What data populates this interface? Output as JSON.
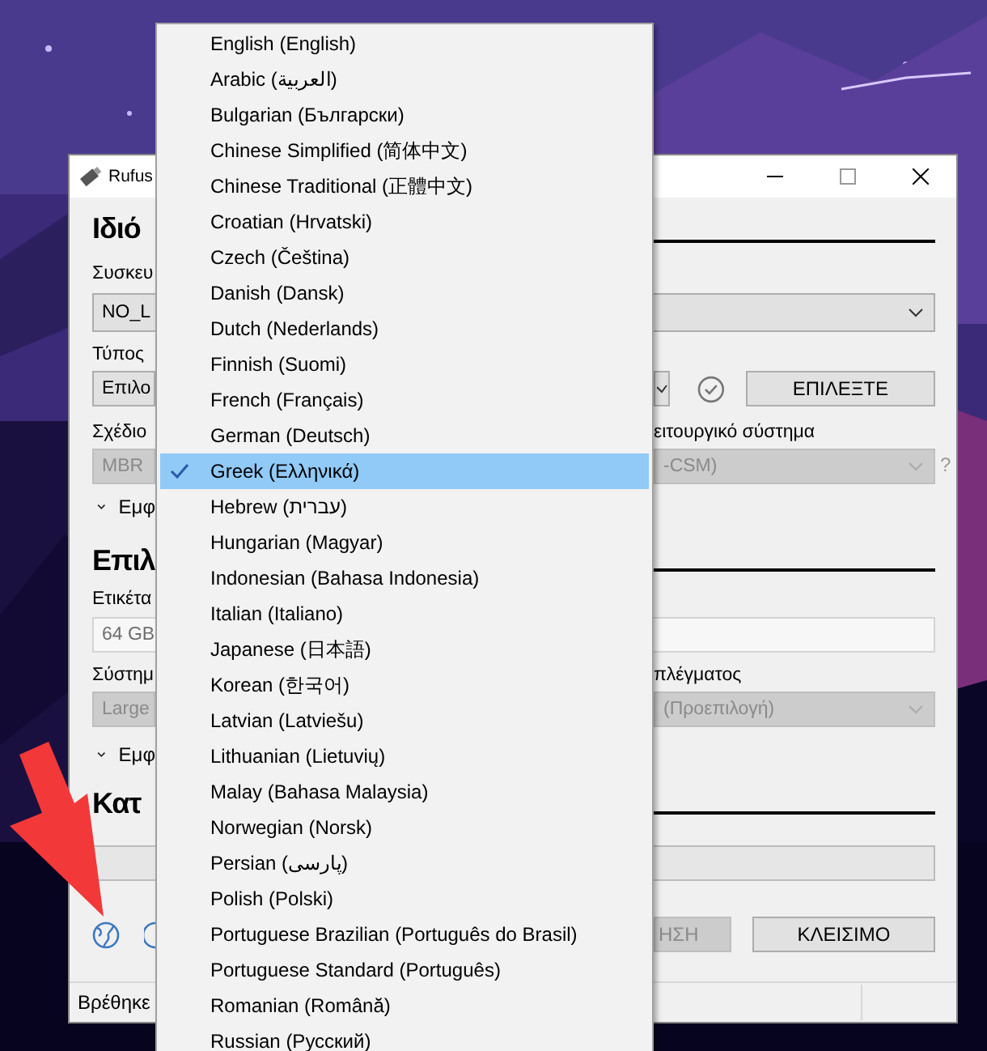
{
  "window": {
    "title": "Rufus"
  },
  "drive_properties": {
    "heading": "Ιδιό",
    "device_label": "Συσκευ",
    "device_value": "NO_L",
    "boot_label": "Τύπος",
    "boot_value": "Επιλο",
    "select_button": "ΕΠΙΛΕΞΤΕ",
    "partition_label": "Σχέδιο",
    "partition_value": "MBR",
    "target_label": "ειτουργικό σύστημα",
    "target_value": "-CSM)",
    "help_mark": "?",
    "advanced_toggle": "Εμφ"
  },
  "format_options": {
    "heading": "Επιλ",
    "volume_label": "Ετικέτα",
    "volume_value": "64 GB",
    "fs_label": "Σύστημ",
    "fs_value": "Large",
    "cluster_label": "πλέγματος",
    "cluster_value": "(Προεπιλογή)",
    "advanced_toggle": "Εμφ"
  },
  "status": {
    "heading": "Κατ",
    "progress": {
      "level": 0
    }
  },
  "buttons": [
    {
      "label": "ΗΣΗ",
      "disabled": true
    },
    {
      "label": "ΚΛΕΙΣΙΜΟ",
      "disabled": false
    }
  ],
  "status_bar": {
    "text": "Βρέθηκε"
  },
  "language_menu": {
    "items": [
      {
        "label": "English (English)",
        "selected": false
      },
      {
        "label": "Arabic (العربية)",
        "selected": false
      },
      {
        "label": "Bulgarian (Български)",
        "selected": false
      },
      {
        "label": "Chinese Simplified (简体中文)",
        "selected": false
      },
      {
        "label": "Chinese Traditional (正體中文)",
        "selected": false
      },
      {
        "label": "Croatian (Hrvatski)",
        "selected": false
      },
      {
        "label": "Czech (Čeština)",
        "selected": false
      },
      {
        "label": "Danish (Dansk)",
        "selected": false
      },
      {
        "label": "Dutch (Nederlands)",
        "selected": false
      },
      {
        "label": "Finnish (Suomi)",
        "selected": false
      },
      {
        "label": "French (Français)",
        "selected": false
      },
      {
        "label": "German (Deutsch)",
        "selected": false
      },
      {
        "label": "Greek (Ελληνικά)",
        "selected": true
      },
      {
        "label": "Hebrew (עברית)",
        "selected": false
      },
      {
        "label": "Hungarian (Magyar)",
        "selected": false
      },
      {
        "label": "Indonesian (Bahasa Indonesia)",
        "selected": false
      },
      {
        "label": "Italian (Italiano)",
        "selected": false
      },
      {
        "label": "Japanese (日本語)",
        "selected": false
      },
      {
        "label": "Korean (한국어)",
        "selected": false
      },
      {
        "label": "Latvian (Latviešu)",
        "selected": false
      },
      {
        "label": "Lithuanian (Lietuvių)",
        "selected": false
      },
      {
        "label": "Malay (Bahasa Malaysia)",
        "selected": false
      },
      {
        "label": "Norwegian (Norsk)",
        "selected": false
      },
      {
        "label": "Persian (پارسی)",
        "selected": false
      },
      {
        "label": "Polish (Polski)",
        "selected": false
      },
      {
        "label": "Portuguese Brazilian (Português do Brasil)",
        "selected": false
      },
      {
        "label": "Portuguese Standard (Português)",
        "selected": false
      },
      {
        "label": "Romanian (Română)",
        "selected": false
      },
      {
        "label": "Russian (Русский)",
        "selected": false
      }
    ]
  }
}
